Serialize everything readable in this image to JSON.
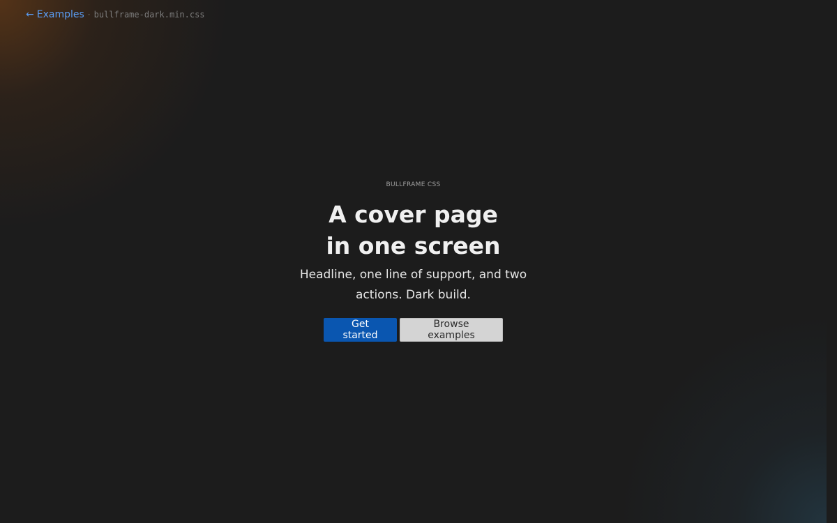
{
  "topbar": {
    "back_arrow": "←",
    "back_label": "Examples",
    "separator": "·",
    "file_name": "bullframe-dark.min.css"
  },
  "hero": {
    "eyebrow": "BULLFRAME CSS",
    "title_line1": "A cover page",
    "title_line2": "in one screen",
    "lead": "Headline, one line of support, and two actions. Dark build."
  },
  "actions": {
    "primary_label": "Get started",
    "secondary_label": "Browse examples"
  },
  "colors": {
    "background": "#1c1c1c",
    "link": "#5a9cf2",
    "primary": "#0a56b0",
    "secondary": "#d4d4d4"
  }
}
